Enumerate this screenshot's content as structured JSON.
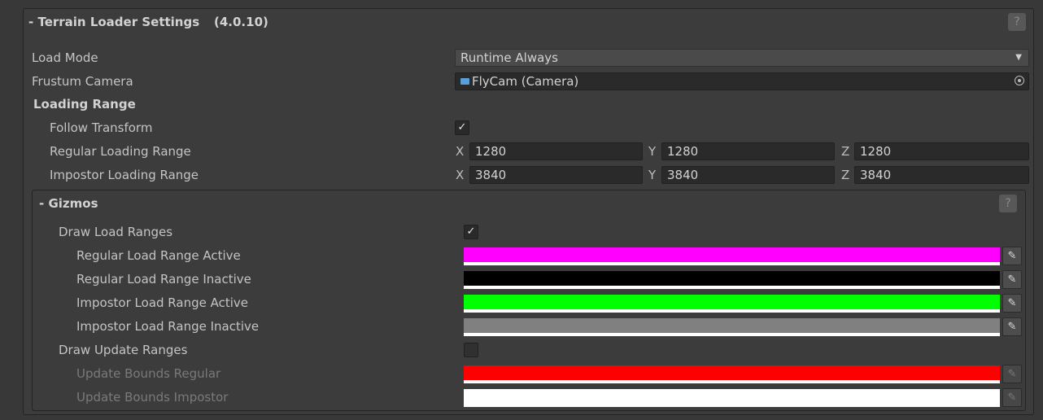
{
  "header": {
    "title": "- Terrain Loader Settings",
    "version": "(4.0.10)",
    "help_glyph": "?"
  },
  "load_mode": {
    "label": "Load Mode",
    "value": "Runtime Always"
  },
  "frustum_camera": {
    "label": "Frustum Camera",
    "value": "FlyCam (Camera)"
  },
  "loading_range": {
    "label": "Loading Range",
    "follow_transform": {
      "label": "Follow Transform",
      "checked": true
    },
    "regular": {
      "label": "Regular Loading Range",
      "x": "1280",
      "y": "1280",
      "z": "1280"
    },
    "impostor": {
      "label": "Impostor Loading Range",
      "x": "3840",
      "y": "3840",
      "z": "3840"
    }
  },
  "axes": {
    "x": "X",
    "y": "Y",
    "z": "Z"
  },
  "gizmos": {
    "title": "- Gizmos",
    "help_glyph": "?",
    "draw_load_ranges": {
      "label": "Draw Load Ranges",
      "checked": true
    },
    "colors": [
      {
        "label": "Regular Load Range Active",
        "color": "#ff00ff"
      },
      {
        "label": "Regular Load Range Inactive",
        "color": "#000000"
      },
      {
        "label": "Impostor Load Range Active",
        "color": "#00ff00"
      },
      {
        "label": "Impostor Load Range Inactive",
        "color": "#808080"
      }
    ],
    "draw_update_ranges": {
      "label": "Draw Update Ranges",
      "checked": false
    },
    "update_colors": [
      {
        "label": "Update Bounds Regular",
        "color": "#ff0000"
      },
      {
        "label": "Update Bounds Impostor",
        "color": "#ffffff"
      }
    ]
  },
  "icons": {
    "check": "✓",
    "eyedropper": "✎",
    "dropdown_arrow": "▼"
  }
}
